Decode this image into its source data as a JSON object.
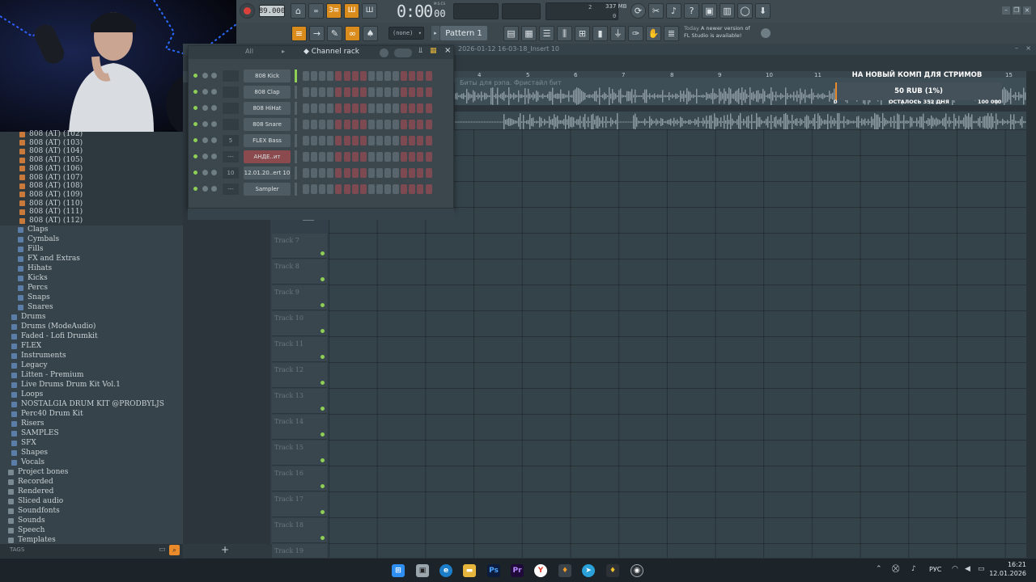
{
  "toolbar": {
    "tempo": "89.000",
    "time": "0:00",
    "time_small": "00",
    "time_label": "M:S:CS",
    "cpu_top": "2",
    "cpu_bottom": "0",
    "memory": "337 MB",
    "pattern_selector": "(none)",
    "pattern": "Pattern 1",
    "hint_day": "Today",
    "hint_text": "A newer version of FL Studio is available!"
  },
  "window_title": "2026-01-12 16-03-18_Insert 10",
  "playlist": {
    "ruler": [
      "4",
      "5",
      "6",
      "7",
      "8",
      "9",
      "10",
      "11",
      "15"
    ],
    "clip_label": "Биты для рэпа. Фристайл бит",
    "tracks": [
      "Track 7",
      "Track 8",
      "Track 9",
      "Track 10",
      "Track 11",
      "Track 12",
      "Track 13",
      "Track 14",
      "Track 15",
      "Track 16",
      "Track 17",
      "Track 18",
      "Track 19"
    ]
  },
  "donation": {
    "title": "НА НОВЫЙ КОМП ДЛЯ СТРИМОВ",
    "amount": "50 RUB (1%)",
    "min": "0",
    "remaining": "ОСТАЛОСЬ 352 ДНЯ",
    "goal": "100 000",
    "progress_percent": 1
  },
  "channel_rack": {
    "filter": "All",
    "title": "Channel rack",
    "add_label": "+",
    "channels": [
      {
        "name": "808 Kick",
        "number": ""
      },
      {
        "name": "808 Clap",
        "number": ""
      },
      {
        "name": "808 HiHat",
        "number": ""
      },
      {
        "name": "808 Snare",
        "number": ""
      },
      {
        "name": "FLEX Bass",
        "number": "5"
      },
      {
        "name": "АНДЕ..ит",
        "number": "---"
      },
      {
        "name": "12.01.20..ert 10",
        "number": "10"
      },
      {
        "name": "Sampler",
        "number": "---"
      }
    ]
  },
  "browser": {
    "samples": [
      "808 (AT) (102)",
      "808 (AT) (103)",
      "808 (AT) (104)",
      "808 (AT) (105)",
      "808 (AT) (106)",
      "808 (AT) (107)",
      "808 (AT) (108)",
      "808 (AT) (109)",
      "808 (AT) (110)",
      "808 (AT) (111)",
      "808 (AT) (112)"
    ],
    "folders": [
      "Claps",
      "Cymbals",
      "Fills",
      "FX and Extras",
      "Hihats",
      "Kicks",
      "Percs",
      "Snaps",
      "Snares",
      "Drums",
      "Drums (ModeAudio)",
      "Faded - Lofi Drumkit",
      "FLEX",
      "Instruments",
      "Legacy",
      "Litten - Premium",
      "Live Drums Drum Kit Vol.1",
      "Loops",
      "NOSTALGIA DRUM KIT @PRODBYLJS",
      "Perc40 Drum Kit",
      "Risers",
      "SAMPLES",
      "SFX",
      "Shapes",
      "Vocals",
      "Project bones",
      "Recorded",
      "Rendered",
      "Sliced audio",
      "Soundfonts",
      "Sounds",
      "Speech",
      "Templates"
    ],
    "tags_label": "TAGS"
  },
  "taskbar": {
    "lang": "РУС",
    "time": "16:21",
    "date": "12.01.2026"
  }
}
